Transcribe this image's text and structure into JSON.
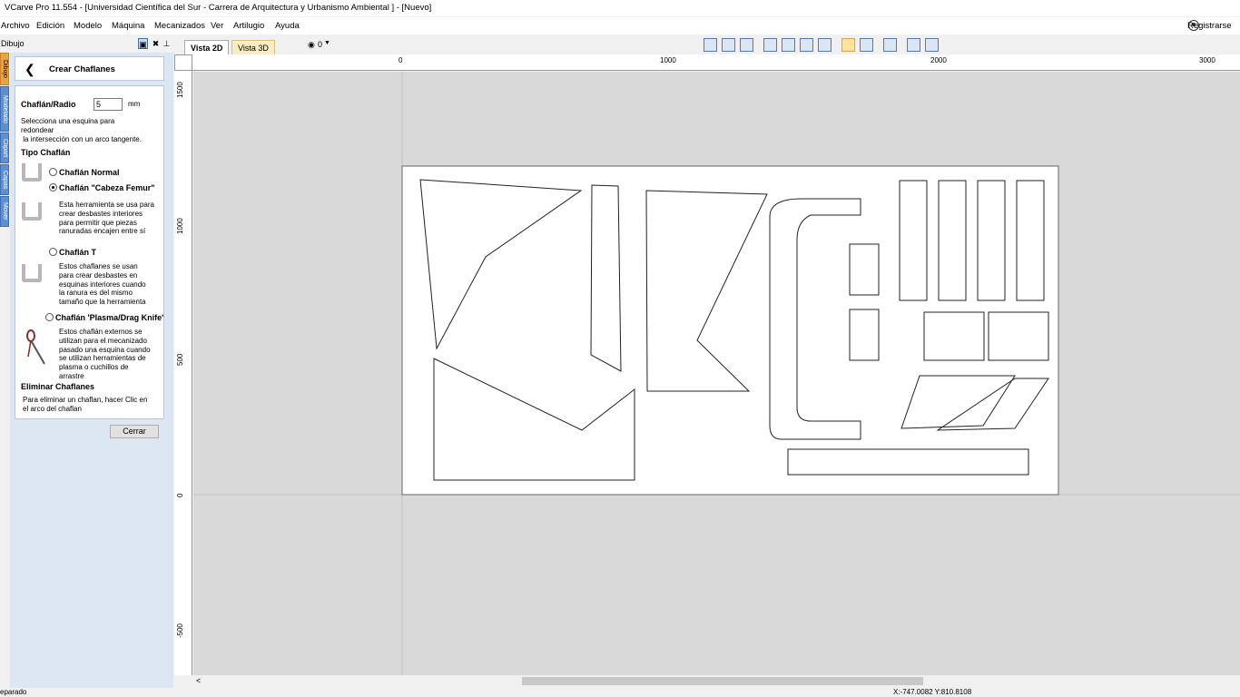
{
  "window": {
    "title": "VCarve Pro 11.554 - [Universidad Científica del Sur - Carrera de Arquitectura y Urbanismo Ambiental ] - [Nuevo]"
  },
  "menu": {
    "items": [
      "Archivo",
      "Edición",
      "Modelo",
      "Máquina",
      "Mecanizados",
      "Ver",
      "Artilugio",
      "Ayuda"
    ],
    "register_label": "Registrarse"
  },
  "panel": {
    "tab_label": "Dibujo",
    "side_tabs": [
      "Dibujo",
      "Modelado",
      "Clipart",
      "Capas",
      "Mover"
    ],
    "header_title": "Crear Chaflanes",
    "radius_label": "Chaflán/Radio",
    "radius_value": "5",
    "radius_unit": "mm",
    "instruction": "Selecciona una esquina para\nredondear\n la intersección con un arco tangente.",
    "type_heading": "Tipo Chaflán",
    "options": [
      {
        "label": "Chaflán Normal",
        "checked": false,
        "description": ""
      },
      {
        "label": "Chaflán \"Cabeza Femur\"",
        "checked": true,
        "description": "Esta herramienta se usa para\ncrear desbastes interiores\npara permitir que piezas\nranuradas encajen entre sí"
      },
      {
        "label": "Chaflán T",
        "checked": false,
        "description": "Estos chaflanes se usan\npara crear desbastes en\nesquinas interiores cuando\nla ranura es del mismo\ntamaño que la herramienta"
      },
      {
        "label": "Chaflán 'Plasma/Drag Knife'",
        "checked": false,
        "description": "Estos chaflán externos se\nutilizan para el mecanizado\npasado una esquina cuando\nse utilizan herramientas de\nplasma o cuchillos de\narrastre"
      }
    ],
    "remove_heading": "Eliminar Chaflanes",
    "remove_text": "Para eliminar un chaflan, hacer Clic en\nel arco del chaflan",
    "close_button": "Cerrar"
  },
  "view_tabs": [
    "Vista 2D",
    "Vista 3D"
  ],
  "layer_dropdown": "0",
  "rulers": {
    "horizontal": [
      "0",
      "1000",
      "2000",
      "3000"
    ],
    "vertical": [
      "1500",
      "1000",
      "500",
      "0",
      "-500"
    ]
  },
  "status": {
    "left": "eparado",
    "coords": "X:-747.0082 Y:810.8108"
  },
  "colors": {
    "canvas_bg": "#d9d9d9",
    "sheet": "#ffffff",
    "panel_bg": "#dde7f4",
    "active_tab": "#e9a341"
  }
}
